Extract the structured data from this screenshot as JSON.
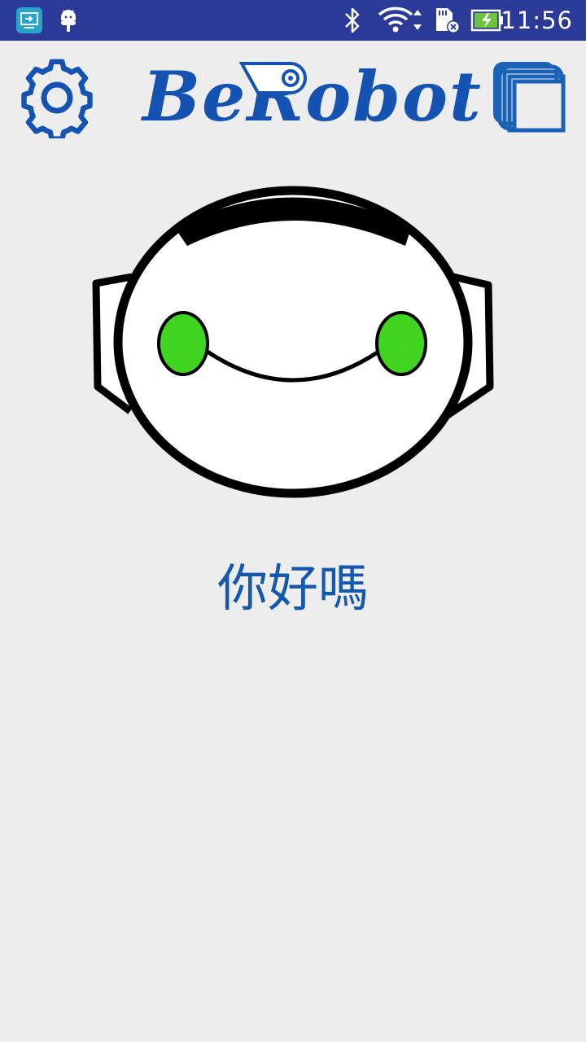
{
  "status_bar": {
    "time": "11:56",
    "icons": [
      "screen-share-icon",
      "android-debug-icon",
      "bluetooth-icon",
      "wifi-icon",
      "sd-card-error-icon",
      "battery-charging-icon"
    ],
    "background": "#2a3a96"
  },
  "header": {
    "settings_icon": "gear-icon",
    "logo_text": "BeRobot",
    "windows_icon": "overlapping-windows-icon",
    "accent_color": "#1553b3"
  },
  "robot": {
    "eye_color": "#3fd420",
    "expression": "smile"
  },
  "greeting": {
    "text": "你好嗎",
    "color": "#1458ab"
  }
}
